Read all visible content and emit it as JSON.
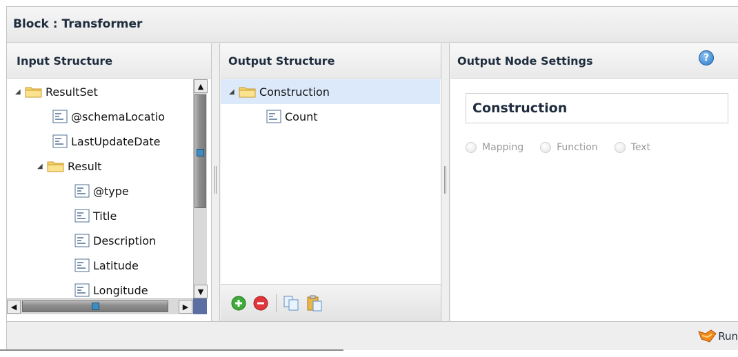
{
  "window": {
    "title": "Block : Transformer"
  },
  "input_panel": {
    "title": "Input Structure",
    "tree": [
      {
        "label": "ResultSet",
        "type": "folder",
        "expanded": true
      },
      {
        "label": "@schemaLocatio",
        "type": "field"
      },
      {
        "label": "LastUpdateDate",
        "type": "field"
      },
      {
        "label": "Result",
        "type": "folder",
        "expanded": true
      },
      {
        "label": "@type",
        "type": "field"
      },
      {
        "label": "Title",
        "type": "field"
      },
      {
        "label": "Description",
        "type": "field"
      },
      {
        "label": "Latitude",
        "type": "field"
      },
      {
        "label": "Longitude",
        "type": "field"
      }
    ]
  },
  "output_panel": {
    "title": "Output Structure",
    "tree": [
      {
        "label": "Construction",
        "type": "folder",
        "expanded": true,
        "selected": true
      },
      {
        "label": "Count",
        "type": "field"
      }
    ],
    "toolbar": [
      "add-icon",
      "remove-icon",
      "copy-icon",
      "paste-icon"
    ]
  },
  "settings_panel": {
    "title": "Output Node Settings",
    "node_name": "Construction",
    "options": [
      "Mapping",
      "Function",
      "Text"
    ]
  },
  "footer": {
    "run_label": "Run"
  },
  "colors": {
    "selected_row": "#dce9fb",
    "title_text": "#1e2c3d",
    "help_blue": "#2b78c9"
  }
}
